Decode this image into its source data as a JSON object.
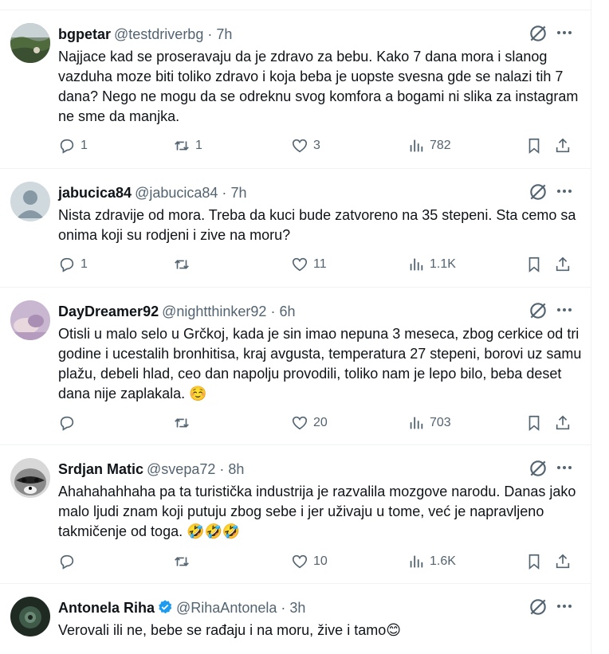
{
  "tweets": [
    {
      "name": "bgpetar",
      "handle": "@testdriverbg",
      "dot": "·",
      "time": "7h",
      "text": "Najjace kad se proseravaju da je zdravo za bebu. Kako 7 dana mora i slanog vazduha moze biti toliko zdravo i koja beba je uopste svesna gde se nalazi tih 7 dana? Nego ne mogu da se odreknu svog komfora a bogami ni slika za instagram ne sme da manjka.",
      "replies": "1",
      "reposts": "1",
      "likes": "3",
      "views": "782"
    },
    {
      "name": "jabucica84",
      "handle": "@jabucica84",
      "dot": "·",
      "time": "7h",
      "text": "Nista zdravije od mora. Treba da kuci bude zatvoreno na 35 stepeni. Sta cemo sa onima koji su rodjeni i zive na moru?",
      "replies": "1",
      "reposts": "",
      "likes": "11",
      "views": "1.1K"
    },
    {
      "name": "DayDreamer92",
      "handle": "@nightthinker92",
      "dot": "·",
      "time": "6h",
      "text": "Otisli u malo selo u Grčkoj, kada je sin imao nepuna 3 meseca, zbog cerkice od tri godine i ucestalih bronhitisa, kraj avgusta, temperatura 27 stepeni, borovi uz samu plažu, debeli hlad, ceo dan napolju provodili, toliko nam je lepo bilo, beba deset dana nije zaplakala.",
      "emoji": "☺️",
      "replies": "",
      "reposts": "",
      "likes": "20",
      "views": "703"
    },
    {
      "name": "Srdjan Matic",
      "handle": "@svepa72",
      "dot": "·",
      "time": "8h",
      "text": "Ahahahahhaha pa ta turistička industrija je razvalila mozgove narodu. Danas jako malo ljudi znam koji putuju zbog sebe i jer uživaju u tome, već je napravljeno takmičenje od toga.",
      "emoji": "🤣🤣🤣",
      "replies": "",
      "reposts": "",
      "likes": "10",
      "views": "1.6K"
    },
    {
      "name": "Antonela Riha",
      "handle": "@RihaAntonela",
      "dot": "·",
      "time": "3h",
      "text": "Verovali ili ne, bebe se rađaju i na moru, žive i tamo",
      "emoji": "😊"
    }
  ],
  "colors": {
    "text": "#0f1419",
    "secondary": "#536471",
    "border": "#eff3f4",
    "verified": "#1d9bf0"
  },
  "icons": {
    "reply": "reply-icon",
    "repost": "repost-icon",
    "like": "like-icon",
    "views": "views-icon",
    "bookmark": "bookmark-icon",
    "share": "share-icon",
    "grok": "grok-icon",
    "more": "more-icon"
  }
}
